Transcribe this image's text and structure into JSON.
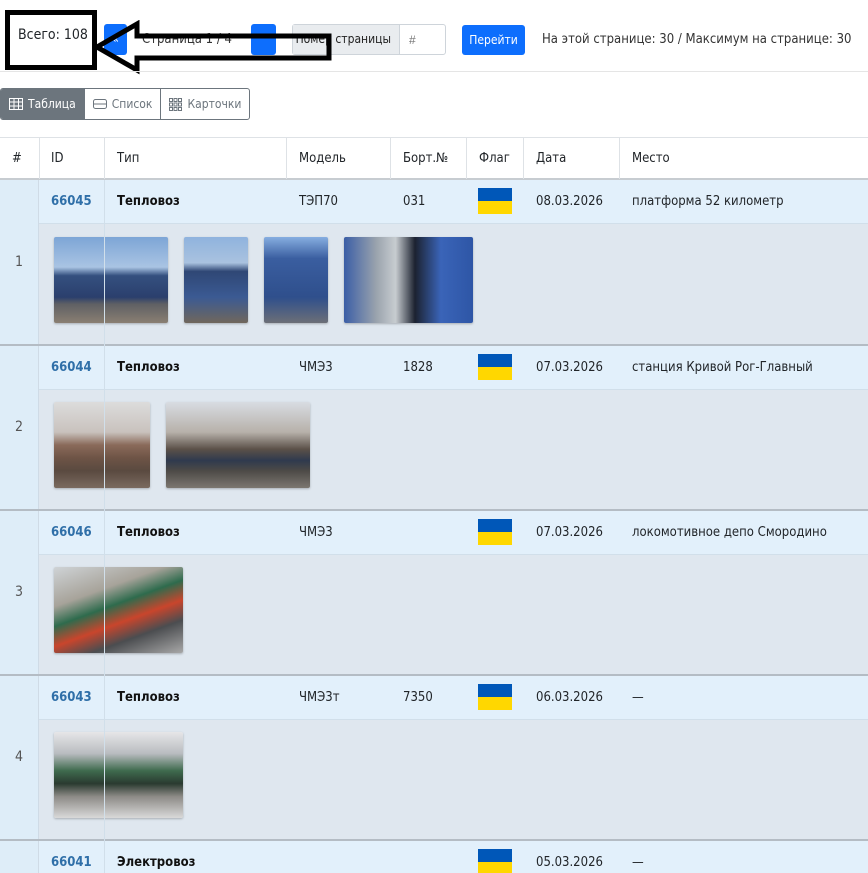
{
  "toolbar": {
    "total": "Всего: 108",
    "prev_label": "«",
    "page_label": "Страница 1 / 4",
    "goto_label": "Номер страницы",
    "goto_placeholder": "#",
    "go_button": "Перейти",
    "page_info": "На этой странице: 30 / Максимум на странице: 30"
  },
  "views": [
    {
      "label": "Таблица",
      "icon": "table-icon",
      "active": true
    },
    {
      "label": "Список",
      "icon": "list-icon",
      "active": false
    },
    {
      "label": "Карточки",
      "icon": "cards-icon",
      "active": false
    }
  ],
  "columns": [
    "#",
    "ID",
    "Тип",
    "Модель",
    "Борт.№",
    "Флаг",
    "Дата",
    "Место"
  ],
  "rows": [
    {
      "num": "1",
      "id": "66045",
      "type": "Тепловоз",
      "model": "ТЭП70",
      "board": "031",
      "flag": "Украина",
      "date": "08.03.2026",
      "place": "платформа 52 километр",
      "photos": 4
    },
    {
      "num": "2",
      "id": "66044",
      "type": "Тепловоз",
      "model": "ЧМЭ3",
      "board": "1828",
      "flag": "Украина",
      "date": "07.03.2026",
      "place": "станция Кривой Рог-Главный",
      "photos": 2
    },
    {
      "num": "3",
      "id": "66046",
      "type": "Тепловоз",
      "model": "ЧМЭ3",
      "board": "",
      "flag": "Украина",
      "date": "07.03.2026",
      "place": "локомотивное депо Смородино",
      "photos": 1
    },
    {
      "num": "4",
      "id": "66043",
      "type": "Тепловоз",
      "model": "ЧМЭ3т",
      "board": "7350",
      "flag": "Украина",
      "date": "06.03.2026",
      "place": "—",
      "photos": 1
    },
    {
      "num": "5",
      "id": "66041",
      "type": "Электровоз",
      "model": "",
      "board": "",
      "flag": "Украина",
      "date": "05.03.2026",
      "place": "—",
      "photos": 0
    }
  ],
  "colors": {
    "accent": "#0d6efd",
    "flag_blue": "#0057b8",
    "flag_yellow": "#ffd700",
    "row_bg": "#e2f0fb",
    "link": "#2f6fa8"
  }
}
